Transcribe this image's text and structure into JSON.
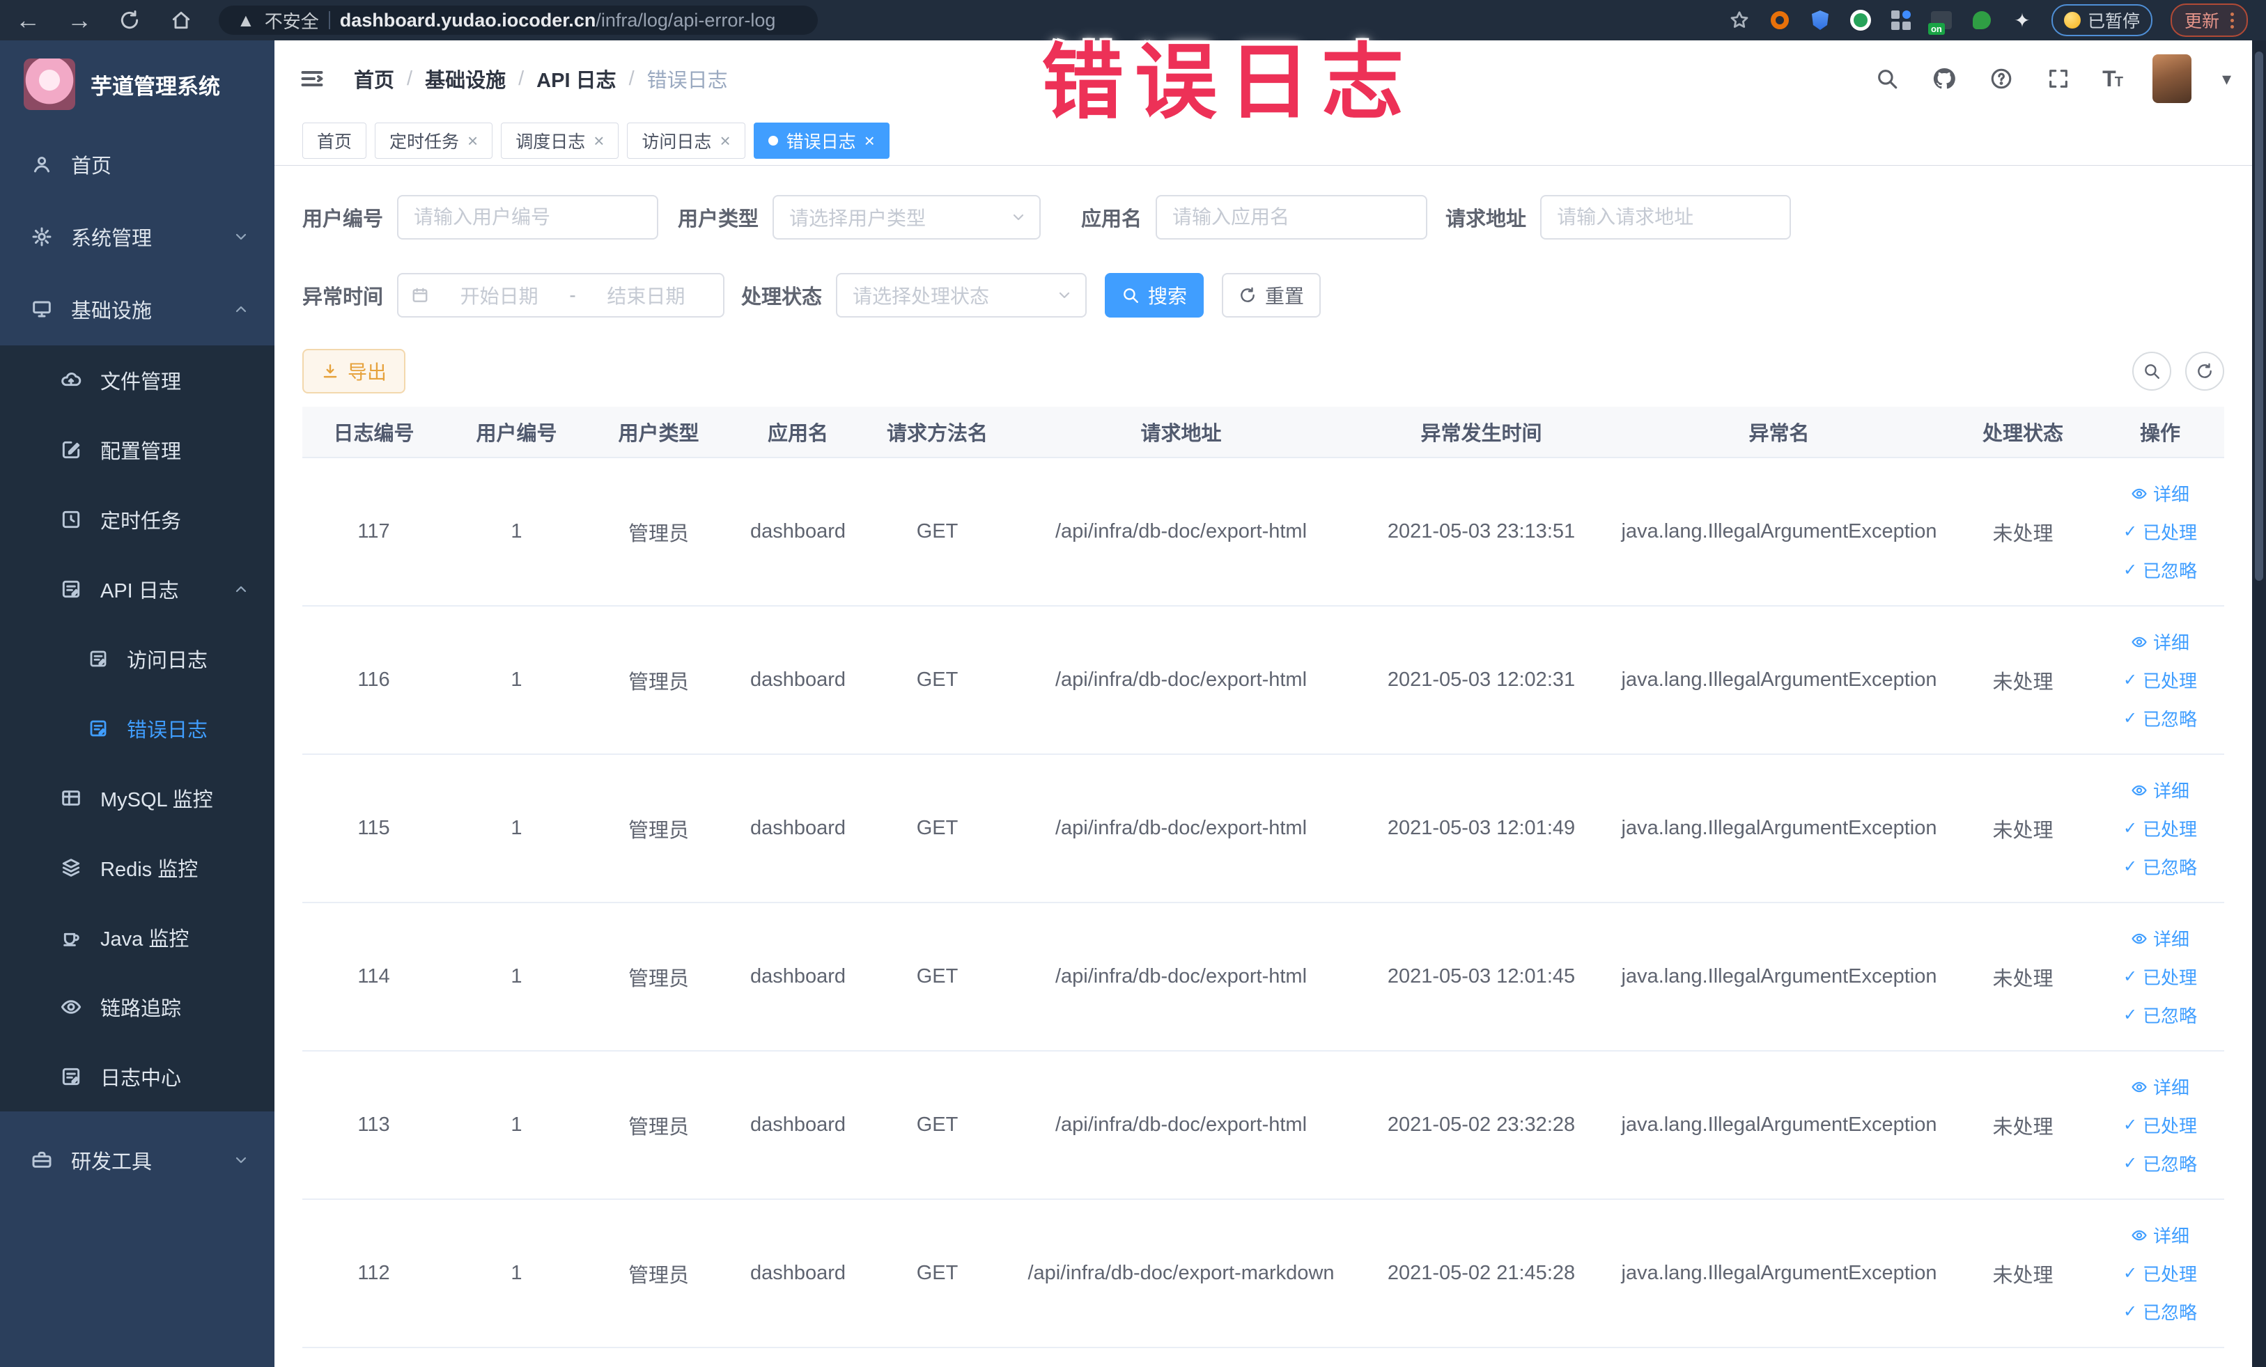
{
  "browser": {
    "security_label": "不安全",
    "url_domain": "dashboard.yudao.iocoder.cn",
    "url_path": "/infra/log/api-error-log",
    "paused_badge": "已暂停",
    "update_label": "更新"
  },
  "annotation": {
    "text": "错误日志"
  },
  "sidebar": {
    "logo_title": "芋道管理系统",
    "items": [
      {
        "label": "首页"
      },
      {
        "label": "系统管理"
      },
      {
        "label": "基础设施"
      },
      {
        "label": "文件管理"
      },
      {
        "label": "配置管理"
      },
      {
        "label": "定时任务"
      },
      {
        "label": "API 日志"
      },
      {
        "label": "访问日志"
      },
      {
        "label": "错误日志"
      },
      {
        "label": "MySQL 监控"
      },
      {
        "label": "Redis 监控"
      },
      {
        "label": "Java 监控"
      },
      {
        "label": "链路追踪"
      },
      {
        "label": "日志中心"
      },
      {
        "label": "研发工具"
      }
    ]
  },
  "breadcrumb": {
    "items": [
      "首页",
      "基础设施",
      "API 日志",
      "错误日志"
    ]
  },
  "tabs": [
    {
      "label": "首页",
      "closable": false,
      "active": false
    },
    {
      "label": "定时任务",
      "closable": true,
      "active": false
    },
    {
      "label": "调度日志",
      "closable": true,
      "active": false
    },
    {
      "label": "访问日志",
      "closable": true,
      "active": false
    },
    {
      "label": "错误日志",
      "closable": true,
      "active": true
    }
  ],
  "filters": {
    "user_id_label": "用户编号",
    "user_id_placeholder": "请输入用户编号",
    "user_type_label": "用户类型",
    "user_type_placeholder": "请选择用户类型",
    "app_label": "应用名",
    "app_placeholder": "请输入应用名",
    "url_label": "请求地址",
    "url_placeholder": "请输入请求地址",
    "time_label": "异常时间",
    "time_start_placeholder": "开始日期",
    "time_separator": "-",
    "time_end_placeholder": "结束日期",
    "status_label": "处理状态",
    "status_placeholder": "请选择处理状态",
    "search_label": "搜索",
    "reset_label": "重置"
  },
  "toolbar": {
    "export_label": "导出"
  },
  "table": {
    "columns": [
      "日志编号",
      "用户编号",
      "用户类型",
      "应用名",
      "请求方法名",
      "请求地址",
      "异常发生时间",
      "异常名",
      "处理状态",
      "操作"
    ],
    "actions": {
      "detail": "详细",
      "processed": "已处理",
      "ignored": "已忽略"
    },
    "rows": [
      {
        "id": "117",
        "user_id": "1",
        "user_type": "管理员",
        "app": "dashboard",
        "method": "GET",
        "url": "/api/infra/db-doc/export-html",
        "time": "2021-05-03 23:13:51",
        "exception": "java.lang.IllegalArgumentException",
        "status": "未处理"
      },
      {
        "id": "116",
        "user_id": "1",
        "user_type": "管理员",
        "app": "dashboard",
        "method": "GET",
        "url": "/api/infra/db-doc/export-html",
        "time": "2021-05-03 12:02:31",
        "exception": "java.lang.IllegalArgumentException",
        "status": "未处理"
      },
      {
        "id": "115",
        "user_id": "1",
        "user_type": "管理员",
        "app": "dashboard",
        "method": "GET",
        "url": "/api/infra/db-doc/export-html",
        "time": "2021-05-03 12:01:49",
        "exception": "java.lang.IllegalArgumentException",
        "status": "未处理"
      },
      {
        "id": "114",
        "user_id": "1",
        "user_type": "管理员",
        "app": "dashboard",
        "method": "GET",
        "url": "/api/infra/db-doc/export-html",
        "time": "2021-05-03 12:01:45",
        "exception": "java.lang.IllegalArgumentException",
        "status": "未处理"
      },
      {
        "id": "113",
        "user_id": "1",
        "user_type": "管理员",
        "app": "dashboard",
        "method": "GET",
        "url": "/api/infra/db-doc/export-html",
        "time": "2021-05-02 23:32:28",
        "exception": "java.lang.IllegalArgumentException",
        "status": "未处理"
      },
      {
        "id": "112",
        "user_id": "1",
        "user_type": "管理员",
        "app": "dashboard",
        "method": "GET",
        "url": "/api/infra/db-doc/export-markdown",
        "time": "2021-05-02 21:45:28",
        "exception": "java.lang.IllegalArgumentException",
        "status": "未处理"
      }
    ]
  },
  "colors": {
    "accent": "#409EFF",
    "warning": "#e6a23c",
    "annotation": "#ed3157"
  }
}
